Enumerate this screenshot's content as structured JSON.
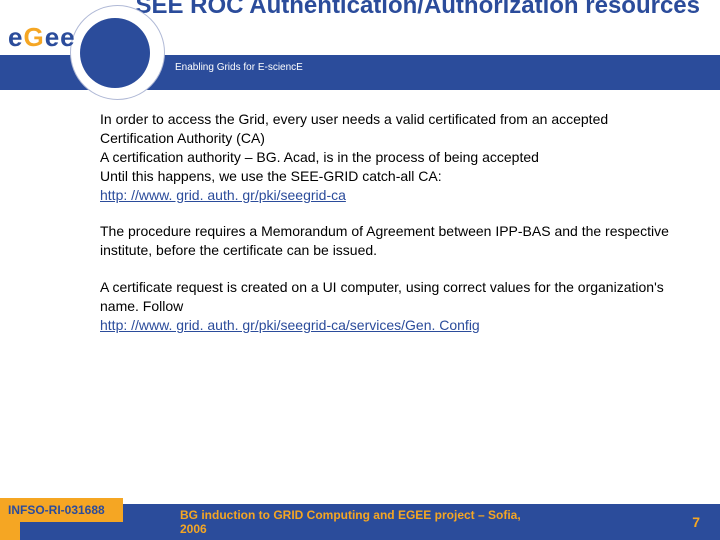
{
  "header": {
    "logo_e1": "e",
    "logo_g": "G",
    "logo_e2": "e",
    "logo_e3": "e",
    "tagline": "Enabling Grids for E-sciencE",
    "title": "SEE ROC Authentication/Authorization resources"
  },
  "content": {
    "para1": "In order to access the Grid, every user needs a valid certificated from an accepted Certification Authority (CA)\nA certification authority – BG. Acad, is in the process of being accepted\nUntil this happens, we use the SEE-GRID catch-all CA:",
    "link1": "http: //www. grid. auth. gr/pki/seegrid-ca",
    "para2": "The procedure requires a Memorandum of Agreement between IPP-BAS and the respective institute, before the certificate can be issued.",
    "para3": "A certificate request is created on a UI computer, using correct values for the organization's name. Follow",
    "link2": "http: //www. grid. auth. gr/pki/seegrid-ca/services/Gen. Config"
  },
  "footer": {
    "left": "INFSO-RI-031688",
    "center": "BG induction to GRID Computing and EGEE project – Sofia, 2006",
    "page": "7"
  }
}
